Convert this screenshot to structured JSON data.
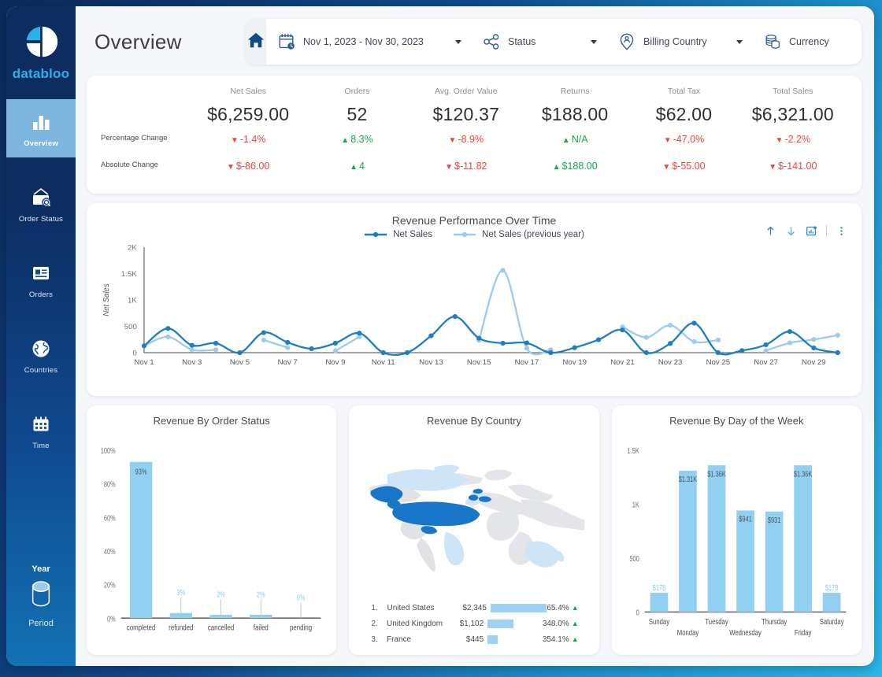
{
  "brand": {
    "name": "databloo",
    "logo_icon": "databloo-logo-icon"
  },
  "sidebar": {
    "items": [
      {
        "label": "Overview",
        "icon": "bar-chart-icon",
        "active": true
      },
      {
        "label": "Order Status",
        "icon": "order-status-icon",
        "active": false
      },
      {
        "label": "Orders",
        "icon": "orders-card-icon",
        "active": false
      },
      {
        "label": "Countries",
        "icon": "globe-icon",
        "active": false
      },
      {
        "label": "Time",
        "icon": "calendar-icon",
        "active": false
      }
    ],
    "bottom": {
      "year_label": "Year",
      "period_label": "Period",
      "icon": "cylinder-icon"
    }
  },
  "header": {
    "title": "Overview",
    "home_icon": "home-icon",
    "filters": [
      {
        "label": "Nov 1, 2023 - Nov 30, 2023",
        "icon": "calendar-clock-icon"
      },
      {
        "label": "Status",
        "icon": "share-nodes-icon"
      },
      {
        "label": "Billing Country",
        "icon": "location-pin-person-icon"
      },
      {
        "label": "Currency",
        "icon": "coins-stack-icon"
      }
    ]
  },
  "kpi": {
    "row_labels": [
      "Percentage Change",
      "Absolute Change"
    ],
    "metrics": [
      {
        "name": "Net Sales",
        "value": "$6,259.00",
        "pct": "-1.4%",
        "pct_dir": "down",
        "abs": "$-86.00",
        "abs_dir": "down"
      },
      {
        "name": "Orders",
        "value": "52",
        "pct": "8.3%",
        "pct_dir": "up",
        "abs": "4",
        "abs_dir": "up"
      },
      {
        "name": "Avg. Order Value",
        "value": "$120.37",
        "pct": "-8.9%",
        "pct_dir": "down",
        "abs": "$-11.82",
        "abs_dir": "down"
      },
      {
        "name": "Returns",
        "value": "$188.00",
        "pct": "N/A",
        "pct_dir": "up",
        "abs": "$188.00",
        "abs_dir": "up"
      },
      {
        "name": "Total Tax",
        "value": "$62.00",
        "pct": "-47.0%",
        "pct_dir": "down",
        "abs": "$-55.00",
        "abs_dir": "down"
      },
      {
        "name": "Total Sales",
        "value": "$6,321.00",
        "pct": "-2.2%",
        "pct_dir": "down",
        "abs": "$-141.00",
        "abs_dir": "down"
      }
    ]
  },
  "line_card": {
    "tools": [
      {
        "icon": "arrow-up-icon"
      },
      {
        "icon": "arrow-down-icon"
      },
      {
        "icon": "chart-insight-icon"
      },
      {
        "icon": "more-vertical-icon"
      }
    ]
  },
  "chart_data": [
    {
      "id": "revenue-performance-over-time",
      "type": "line",
      "title": "Revenue Performance Over Time",
      "xlabel": "",
      "ylabel": "Net Sales",
      "ylim": [
        0,
        2000
      ],
      "yticks": [
        0,
        500,
        1000,
        1500,
        2000
      ],
      "ytick_labels": [
        "0",
        "500",
        "1K",
        "1.5K",
        "2K"
      ],
      "grid": false,
      "legend_position": "top-center",
      "x": [
        "Nov 1",
        "Nov 2",
        "Nov 3",
        "Nov 4",
        "Nov 5",
        "Nov 6",
        "Nov 7",
        "Nov 8",
        "Nov 9",
        "Nov 10",
        "Nov 11",
        "Nov 12",
        "Nov 13",
        "Nov 14",
        "Nov 15",
        "Nov 16",
        "Nov 17",
        "Nov 18",
        "Nov 19",
        "Nov 20",
        "Nov 21",
        "Nov 22",
        "Nov 23",
        "Nov 24",
        "Nov 25",
        "Nov 26",
        "Nov 27",
        "Nov 28",
        "Nov 29",
        "Nov 30"
      ],
      "xtick_labels": [
        "Nov 1",
        "Nov 3",
        "Nov 5",
        "Nov 7",
        "Nov 9",
        "Nov 11",
        "Nov 13",
        "Nov 15",
        "Nov 17",
        "Nov 19",
        "Nov 21",
        "Nov 23",
        "Nov 25",
        "Nov 27",
        "Nov 29"
      ],
      "series": [
        {
          "name": "Net Sales",
          "color": "#1f7ec0",
          "values": [
            130,
            460,
            140,
            180,
            0,
            380,
            195,
            75,
            180,
            370,
            0,
            0,
            320,
            685,
            275,
            180,
            185,
            0,
            95,
            245,
            430,
            0,
            175,
            560,
            0,
            40,
            150,
            400,
            90,
            0
          ]
        },
        {
          "name": "Net Sales (previous year)",
          "color": "#9ecbec",
          "values": [
            130,
            300,
            55,
            55,
            null,
            240,
            95,
            null,
            35,
            300,
            null,
            null,
            null,
            null,
            235,
            1560,
            85,
            55,
            null,
            null,
            490,
            290,
            520,
            210,
            240,
            null,
            40,
            185,
            250,
            330
          ]
        }
      ]
    },
    {
      "id": "revenue-by-order-status",
      "type": "bar",
      "title": "Revenue By Order Status",
      "categories": [
        "completed",
        "refunded",
        "cancelled",
        "failed",
        "pending"
      ],
      "values": [
        93,
        3,
        2,
        2,
        0
      ],
      "data_labels": [
        "93%",
        "3%",
        "2%",
        "2%",
        "0%"
      ],
      "ylim": [
        0,
        100
      ],
      "yticks": [
        0,
        20,
        40,
        60,
        80,
        100
      ],
      "ytick_labels": [
        "0%",
        "20%",
        "40%",
        "60%",
        "80%",
        "100%"
      ],
      "bar_color": "#92d0f2",
      "xlabel": "",
      "ylabel": "",
      "grid": false
    },
    {
      "id": "revenue-by-country",
      "type": "table",
      "title": "Revenue By Country",
      "map": true,
      "columns": [
        "rank",
        "country",
        "revenue",
        "bar",
        "change"
      ],
      "rows": [
        {
          "rank": "1.",
          "country": "United States",
          "revenue": "$2,345",
          "bar_pct": 100,
          "change": "65.4%",
          "dir": "up"
        },
        {
          "rank": "2.",
          "country": "United Kingdom",
          "revenue": "$1,102",
          "bar_pct": 47,
          "change": "348.0%",
          "dir": "up"
        },
        {
          "rank": "3.",
          "country": "France",
          "revenue": "$445",
          "bar_pct": 19,
          "change": "354.1%",
          "dir": "up"
        }
      ]
    },
    {
      "id": "revenue-by-day-of-week",
      "type": "bar",
      "title": "Revenue By Day of the Week",
      "categories": [
        "Sunday",
        "Monday",
        "Tuesday",
        "Wednesday",
        "Thursday",
        "Friday",
        "Saturday"
      ],
      "values": [
        178,
        1310,
        1360,
        941,
        931,
        1360,
        178
      ],
      "data_labels": [
        "$178",
        "$1.31K",
        "$1.36K",
        "$941",
        "$931",
        "$1.36K",
        "$178"
      ],
      "ylim": [
        0,
        1500
      ],
      "yticks": [
        0,
        500,
        1000,
        1500
      ],
      "ytick_labels": [
        "0",
        "500",
        "1K",
        "1.5K"
      ],
      "bar_color": "#92d0f2",
      "xlabel": "",
      "ylabel": "",
      "grid": false
    }
  ],
  "colors": {
    "brand_blue": "#2bb0e8",
    "sidebar_dark": "#0d2d61",
    "sidebar_light": "#1272b4",
    "active_item": "#7fb6df",
    "series_primary": "#1f7ec0",
    "series_secondary": "#9ecbec",
    "bar_fill": "#92d0f2",
    "positive": "#1aa64b",
    "negative": "#ef4444",
    "page_bg": "#f5f7fa"
  }
}
